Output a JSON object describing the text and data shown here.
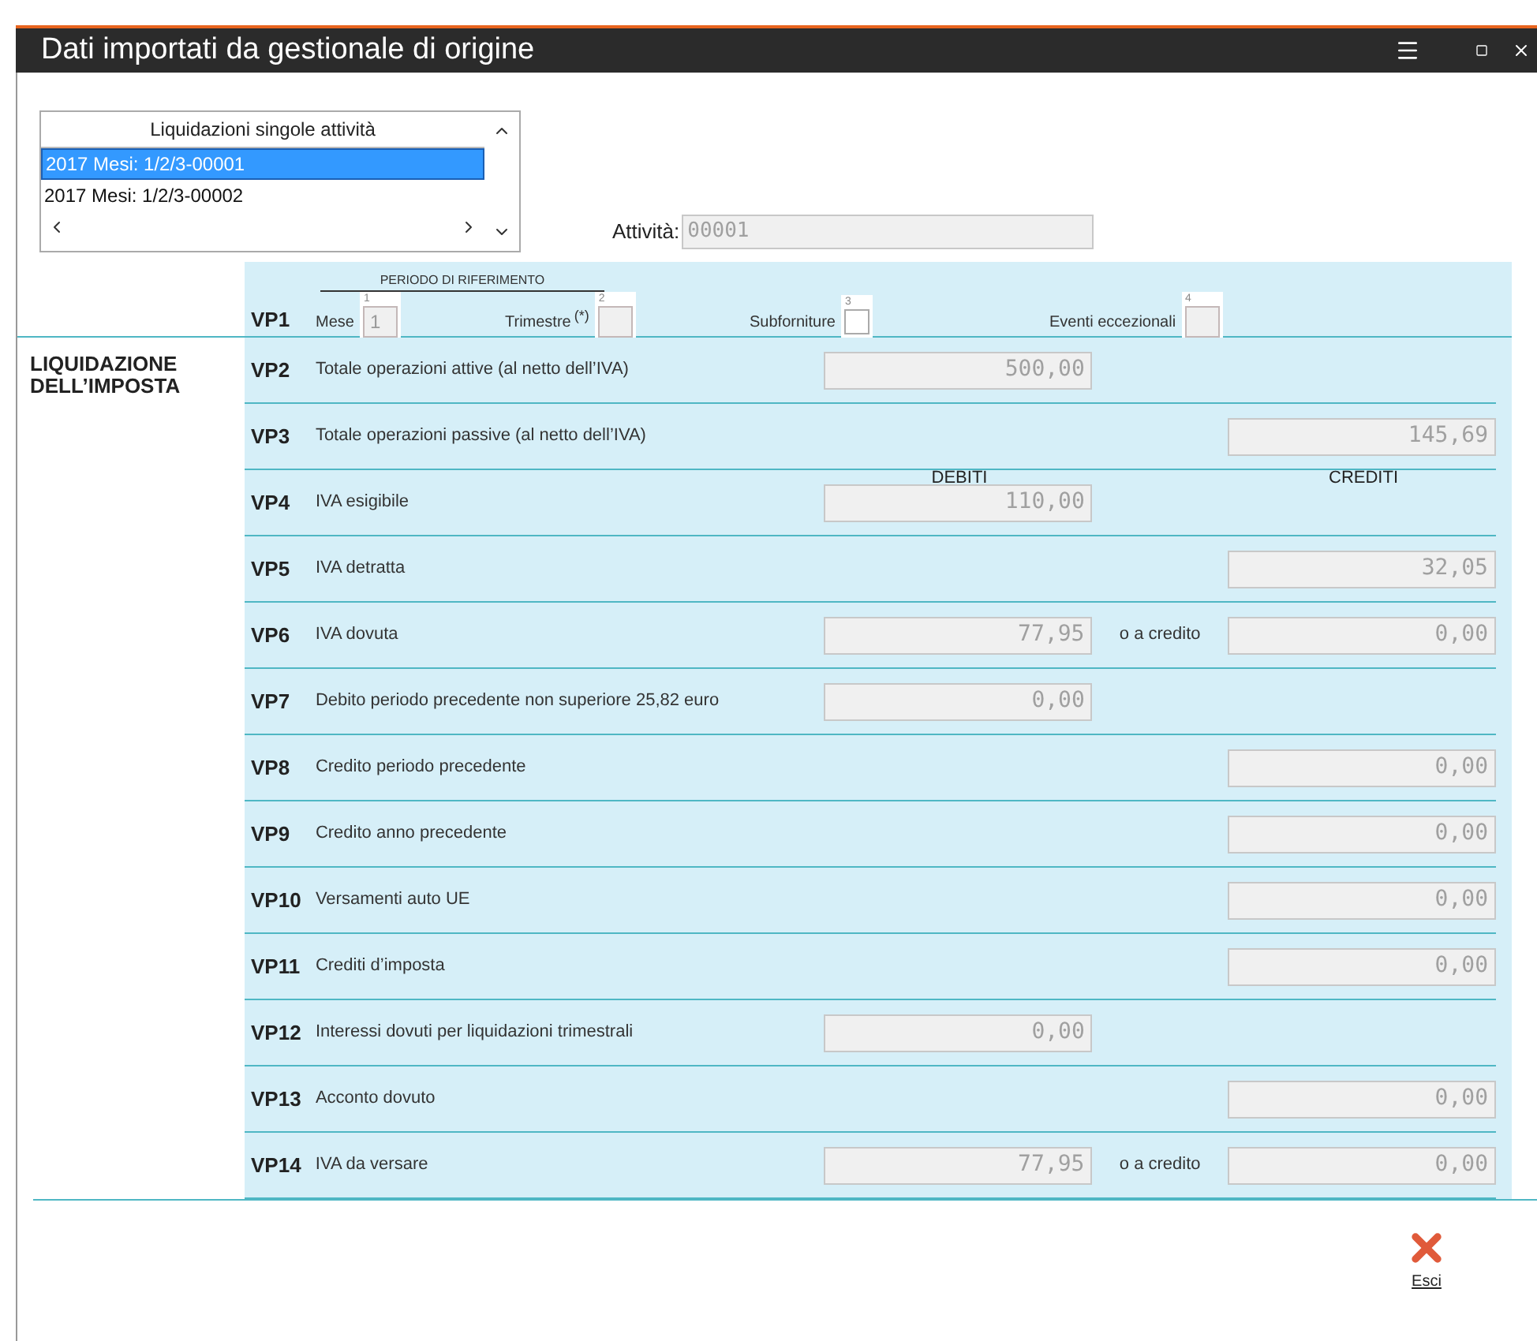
{
  "window": {
    "title": "Dati importati da gestionale di origine"
  },
  "list": {
    "header": "Liquidazioni singole attività",
    "items": [
      {
        "label": "2017 Mesi: 1/2/3-00001",
        "selected": true
      },
      {
        "label": "2017 Mesi: 1/2/3-00002",
        "selected": false
      }
    ]
  },
  "attivita": {
    "label": "Attività:",
    "value": "00001"
  },
  "section_title": "LIQUIDAZIONE DELL’IMPOSTA",
  "vp1": {
    "code": "VP1",
    "heading": "PERIODO DI RIFERIMENTO",
    "fields": [
      {
        "kind": "field",
        "number": "1",
        "label": "Mese",
        "value": "1"
      },
      {
        "kind": "field",
        "number": "2",
        "label": "Trimestre",
        "note": "(*)"
      },
      {
        "kind": "checkbox",
        "number": "3",
        "label": "Subforniture",
        "checked": false
      },
      {
        "kind": "field",
        "number": "4",
        "label": "Eventi eccezionali"
      }
    ]
  },
  "column_headers": {
    "debit": "DEBITI",
    "credit": "CREDITI"
  },
  "rows": [
    {
      "code": "VP2",
      "label": "Totale operazioni attive (al netto dell’IVA)",
      "debit": "500,00"
    },
    {
      "code": "VP3",
      "label": "Totale operazioni passive (al netto dell’IVA)",
      "credit": "145,69"
    },
    {
      "code": "VP4",
      "label": "IVA esigibile",
      "debit": "110,00"
    },
    {
      "code": "VP5",
      "label": "IVA detratta",
      "credit": "32,05"
    },
    {
      "code": "VP6",
      "label": "IVA dovuta",
      "debit": "77,95",
      "or": "o a credito",
      "credit": "0,00"
    },
    {
      "code": "VP7",
      "label": "Debito periodo precedente non superiore 25,82 euro",
      "debit": "0,00"
    },
    {
      "code": "VP8",
      "label": "Credito periodo precedente",
      "credit": "0,00"
    },
    {
      "code": "VP9",
      "label": "Credito anno precedente",
      "credit": "0,00"
    },
    {
      "code": "VP10",
      "label": "Versamenti auto UE",
      "credit": "0,00"
    },
    {
      "code": "VP11",
      "label": "Crediti d’imposta",
      "credit": "0,00"
    },
    {
      "code": "VP12",
      "label": "Interessi dovuti per liquidazioni trimestrali",
      "debit": "0,00"
    },
    {
      "code": "VP13",
      "label": "Acconto dovuto",
      "credit": "0,00"
    },
    {
      "code": "VP14",
      "label": "IVA da versare",
      "debit": "77,95",
      "or": "o a credito",
      "credit": "0,00"
    }
  ],
  "exit_button": {
    "label": "Esci"
  }
}
